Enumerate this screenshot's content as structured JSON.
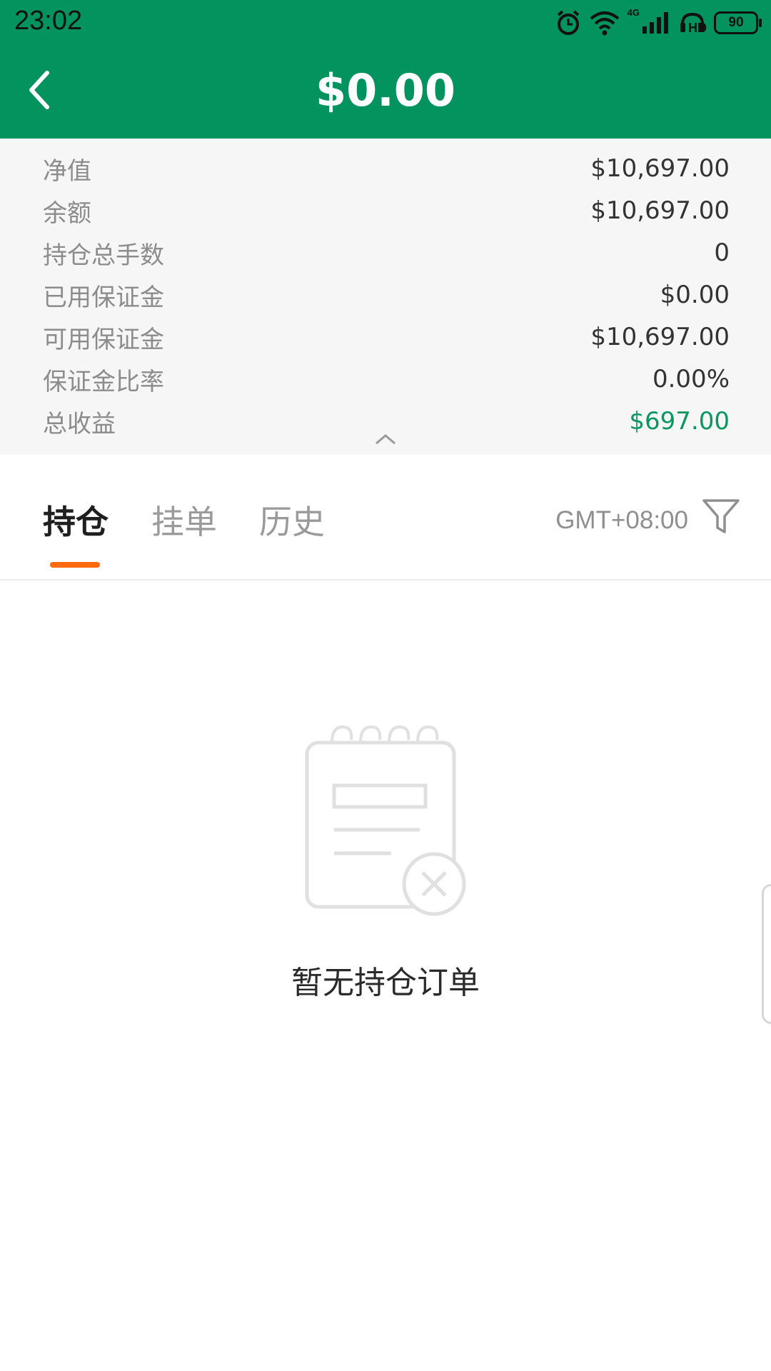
{
  "status_bar": {
    "time": "23:02",
    "network": "4G",
    "hd": "HD",
    "battery": "90",
    "icons": [
      "alarm-icon",
      "wifi-icon",
      "signal-icon",
      "hd-icon",
      "battery-icon"
    ]
  },
  "header": {
    "title": "$0.00",
    "back_icon": "chevron-left-icon",
    "background": "#02935f"
  },
  "summary": {
    "rows": [
      {
        "label": "净值",
        "value": "$10,697.00"
      },
      {
        "label": "余额",
        "value": "$10,697.00"
      },
      {
        "label": "持仓总手数",
        "value": "0"
      },
      {
        "label": "已用保证金",
        "value": "$0.00"
      },
      {
        "label": "可用保证金",
        "value": "$10,697.00"
      },
      {
        "label": "保证金比率",
        "value": "0.00%"
      },
      {
        "label": "总收益",
        "value": "$697.00",
        "color": "#08985f"
      }
    ],
    "collapse_icon": "chevron-up-icon"
  },
  "tabs": {
    "items": [
      {
        "label": "持仓",
        "active": true
      },
      {
        "label": "挂单",
        "active": false
      },
      {
        "label": "历史",
        "active": false
      }
    ],
    "accent": "#ff6a10",
    "timezone": "GMT+08:00",
    "filter_icon": "filter-icon"
  },
  "empty_state": {
    "icon": "empty-notepad-icon",
    "text": "暂无持仓订单"
  }
}
